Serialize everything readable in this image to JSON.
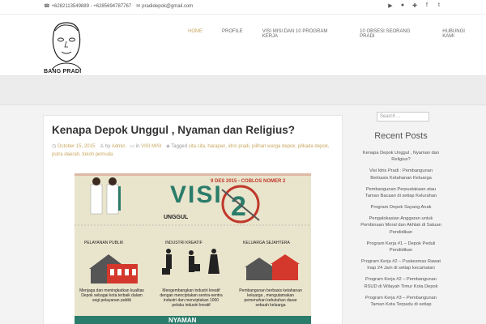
{
  "topbar": {
    "phones": "+6282113549889 - +6285694787767",
    "email": "pradidepok@gmail.com",
    "social_icons": [
      "youtube-icon",
      "flickr-icon",
      "google-plus-icon",
      "facebook-icon",
      "twitter-icon"
    ]
  },
  "header": {
    "logo_text": "BANG PRADI",
    "nav": [
      {
        "label": "HOME",
        "active": true
      },
      {
        "label": "PROFILE",
        "active": false
      },
      {
        "label": "VISI MISI DAN 10 PROGRAM KERJA",
        "active": false
      },
      {
        "label": "10 OBSESI SEORANG PRADI",
        "active": false
      },
      {
        "label": "HUBUNGI KAMI",
        "active": false
      }
    ]
  },
  "post": {
    "title": "Kenapa Depok Unggul , Nyaman dan Religius?",
    "date": "October 15, 2015",
    "by": "by",
    "author": "Admin",
    "in": "in",
    "category": "VISI MISI",
    "tagged": "Tagged",
    "tags": "cita cita, harapan, idris pradi, pilihan warga depok, pilkada depok, putra daerah, tokoh pemuda"
  },
  "banner": {
    "date_text": "9 DES 2015 - COBLOS NOMER 2",
    "visi": "VISI",
    "unggul": "UNGGUL",
    "col1_title": "PELAYANAN PUBLIK",
    "col2_title": "INDUSTRI KREATIF",
    "col3_title": "KELUARGA SEJAHTERA",
    "col1_text": "Menjaga dan meningkatkan kualitas Depok sebagai kota terbaik dalam segi pelayanan publik",
    "col2_text": "Mengembangkan industri kreatif dengan menciptakan sentra-sentra industri dan menciptakan 1000 pelaku industri kreatif",
    "col3_text": "Pembangunan berbasis ketahanan keluarga , mengutamakan pemenuhan kebutuhan dasar sebuah keluarga",
    "nyaman": "NYAMAN"
  },
  "sidebar": {
    "search_placeholder": "Search ...",
    "recent_title": "Recent Posts",
    "recent": [
      "Kenapa Depok Unggul , Nyaman dan Religius?",
      "Visi Idris Pradi : Pembangunan Berbasis Ketahanan Keluarga",
      "Pembangunan Perpustakaan atau Taman Bacaan di setiap Kelurahan",
      "Program Depok Sayang Anak",
      "Pengalokasian Anggaran untuk Pembinaan Moral dan Akhlak di Satuan Pendidikan",
      "Program Kerja #1 – Depok Peduli Pendidikan",
      "Program Kerja #2 – Puskesmas Rawat Inap 24 Jam di setiap kecamatan",
      "Program Kerja #2 – Pembangunan RSUD di Wilayah Timur Kota Depok",
      "Program Kerja #3 – Pembangunan Taman Kota Terpadu di setiap"
    ]
  }
}
